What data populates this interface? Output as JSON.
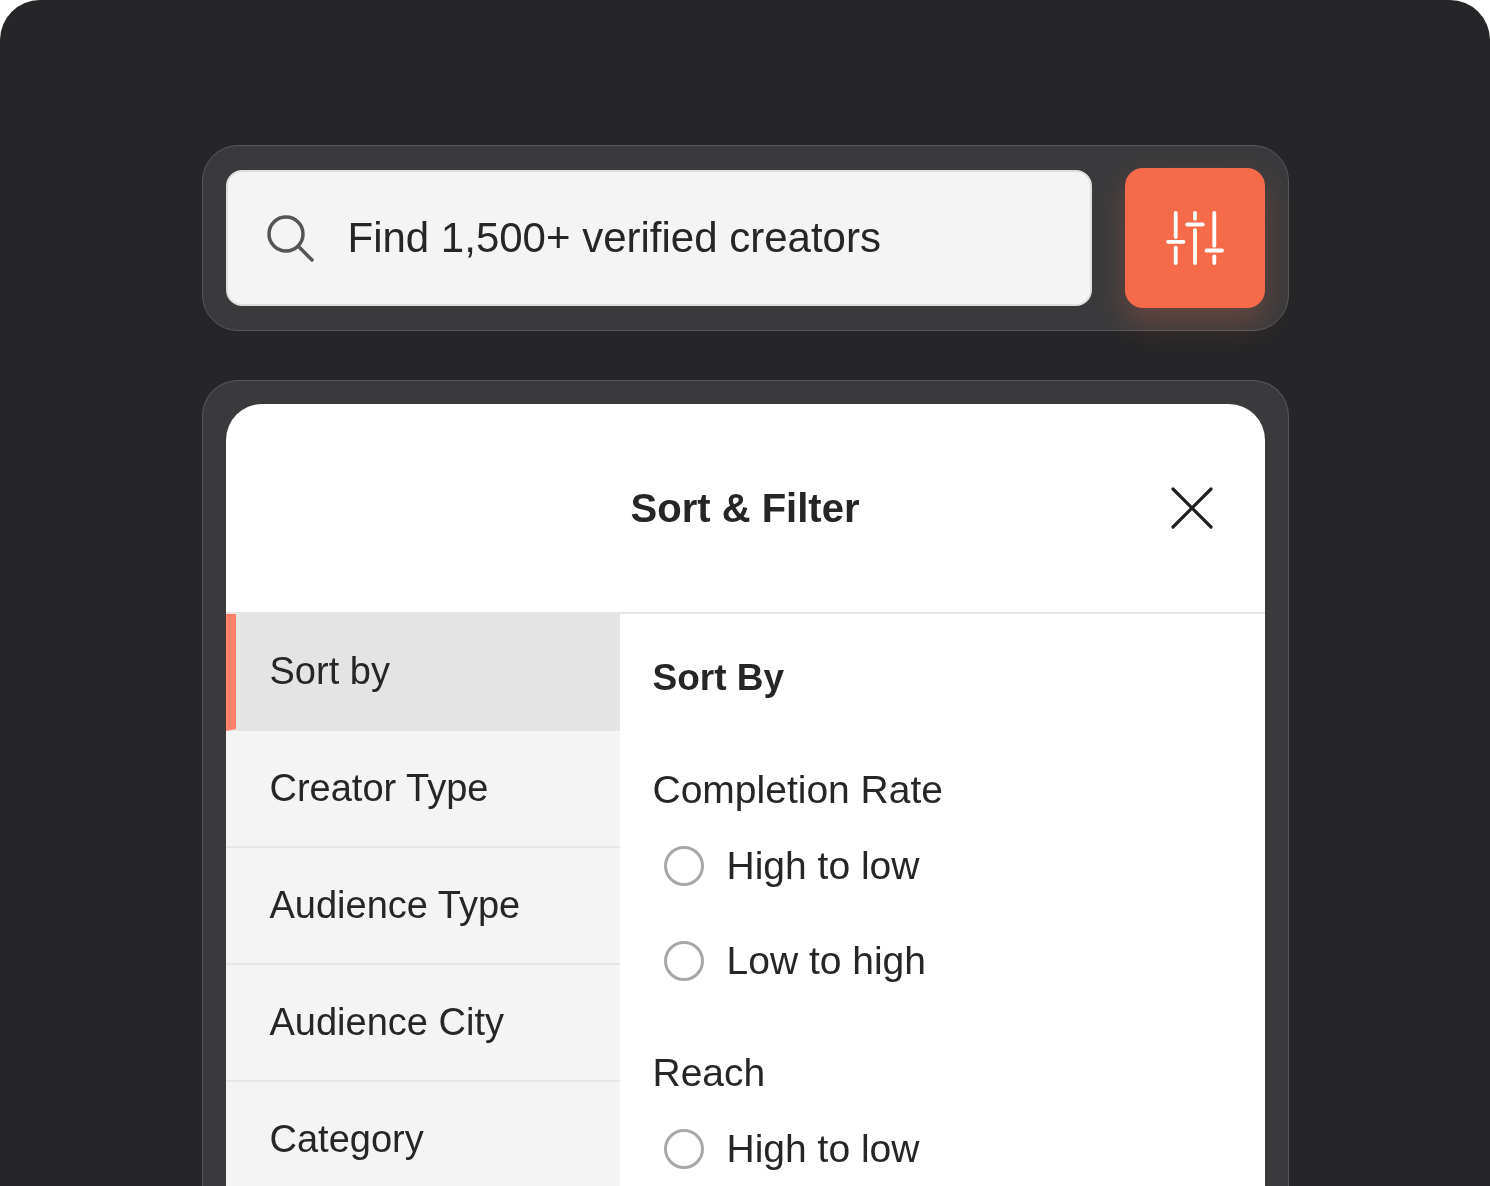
{
  "search": {
    "placeholder": "Find 1,500+ verified creators"
  },
  "panel": {
    "title": "Sort & Filter"
  },
  "sidebar": {
    "items": [
      {
        "label": "Sort by",
        "selected": true
      },
      {
        "label": "Creator Type",
        "selected": false
      },
      {
        "label": "Audience Type",
        "selected": false
      },
      {
        "label": "Audience City",
        "selected": false
      },
      {
        "label": "Category",
        "selected": false
      }
    ]
  },
  "content": {
    "heading": "Sort By",
    "groups": [
      {
        "label": "Completion Rate",
        "options": [
          {
            "label": "High to low",
            "selected": false
          },
          {
            "label": "Low to high",
            "selected": false
          }
        ]
      },
      {
        "label": "Reach",
        "options": [
          {
            "label": "High to low",
            "selected": false
          }
        ]
      }
    ]
  }
}
